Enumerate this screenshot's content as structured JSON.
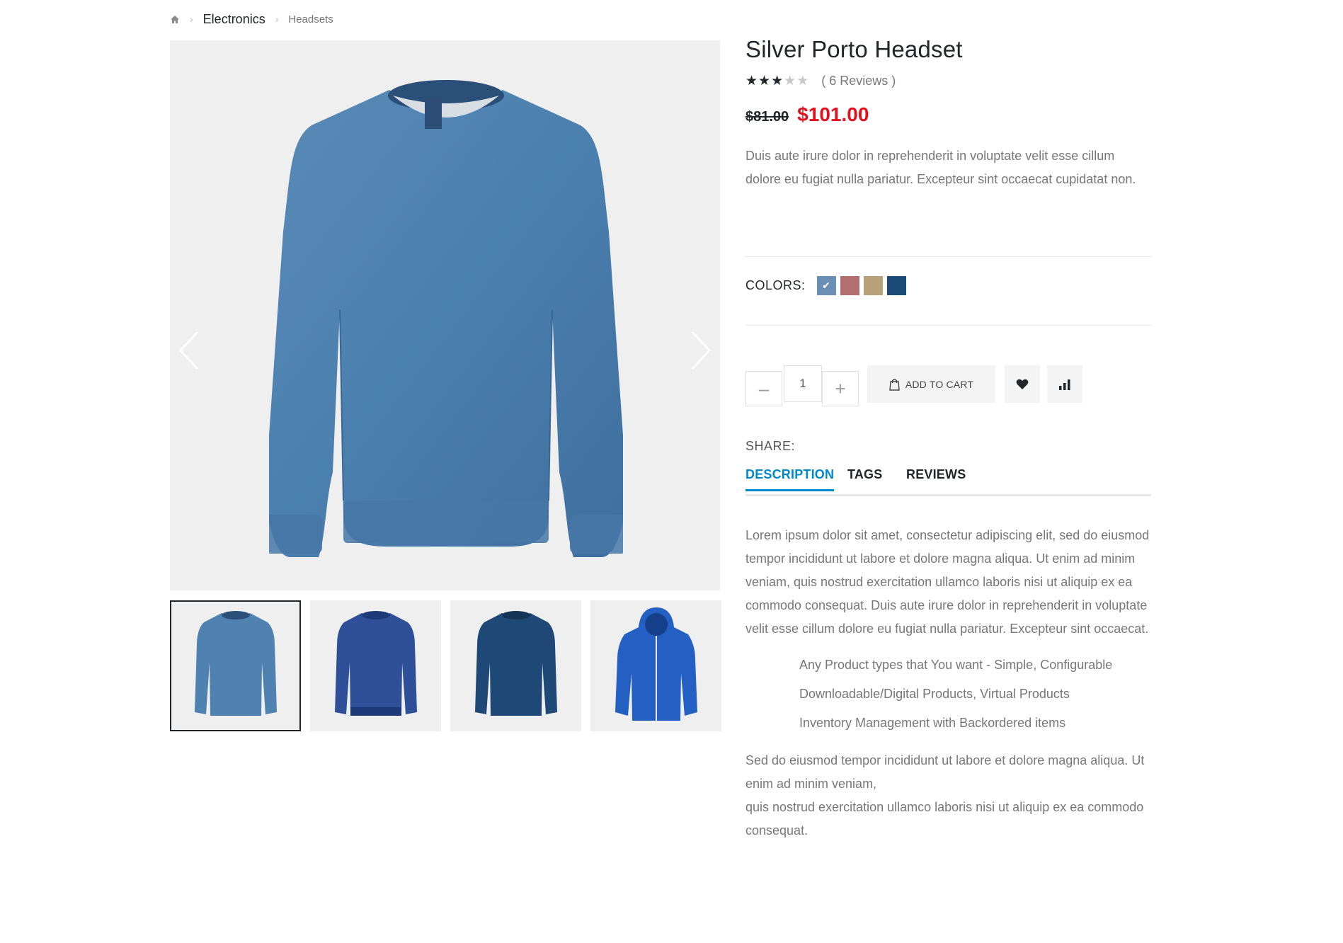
{
  "breadcrumb": {
    "home_icon": "home-icon",
    "items": [
      {
        "label": "Electronics"
      },
      {
        "label": "Headsets"
      }
    ]
  },
  "gallery": {
    "main_image": "blue crew-neck sweater",
    "thumbnails": [
      {
        "name": "light blue sweater",
        "color": "#4f82b0",
        "active": true
      },
      {
        "name": "royal blue sweater",
        "color": "#2f4f99",
        "active": false
      },
      {
        "name": "navy sweater",
        "color": "#1e4876",
        "active": false
      },
      {
        "name": "blue hoodie",
        "color": "#2460c4",
        "active": false
      }
    ]
  },
  "product": {
    "title": "Silver Porto Headset",
    "rating": 3,
    "rating_max": 5,
    "reviews_text": "( 6 Reviews )",
    "old_price": "$81.00",
    "new_price": "$101.00",
    "short_description": "Duis aute irure dolor in reprehenderit in voluptate velit esse cillum dolore eu fugiat nulla pariatur. Excepteur sint occaecat cupidatat non."
  },
  "colors": {
    "label": "COLORS:",
    "swatches": [
      {
        "hex": "#6a8fb4",
        "selected": true
      },
      {
        "hex": "#b36f6f",
        "selected": false
      },
      {
        "hex": "#b8a077",
        "selected": false
      },
      {
        "hex": "#1a4a78",
        "selected": false
      }
    ]
  },
  "cart": {
    "quantity": "1",
    "minus_label": "–",
    "plus_label": "+",
    "add_to_cart_label": "ADD TO CART"
  },
  "share": {
    "label": "SHARE:"
  },
  "tabs": [
    {
      "label": "DESCRIPTION",
      "active": true
    },
    {
      "label": "TAGS",
      "active": false
    },
    {
      "label": "REVIEWS",
      "active": false
    }
  ],
  "description": {
    "paragraph1": "Lorem ipsum dolor sit amet, consectetur adipiscing elit, sed do eiusmod tempor incididunt ut labore et dolore magna aliqua. Ut enim ad minim veniam, quis nostrud exercitation ullamco laboris nisi ut aliquip ex ea commodo consequat. Duis aute irure dolor in reprehenderit in voluptate velit esse cillum dolore eu fugiat nulla pariatur. Excepteur sint occaecat.",
    "features": [
      "Any Product types that You want - Simple, Configurable",
      "Downloadable/Digital Products, Virtual Products",
      "Inventory Management with Backordered items"
    ],
    "paragraph2_line1": "Sed do eiusmod tempor incididunt ut labore et dolore magna aliqua. Ut enim ad minim veniam,",
    "paragraph2_line2": "quis nostrud exercitation ullamco laboris nisi ut aliquip ex ea commodo consequat."
  },
  "colors_theme": {
    "accent": "#0088cc",
    "sale_price": "#e4101e",
    "heading": "#222529"
  }
}
